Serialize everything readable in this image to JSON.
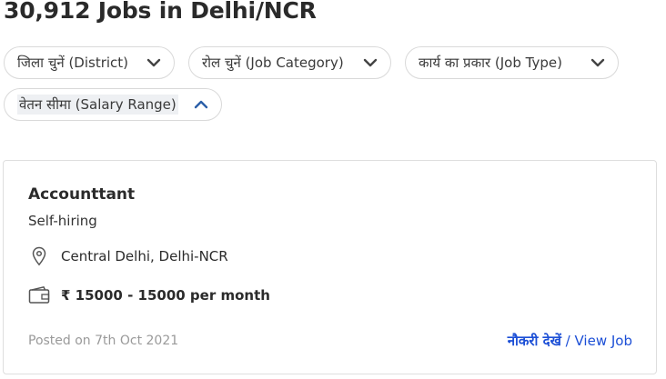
{
  "header": {
    "title": "30,912 Jobs in Delhi/NCR"
  },
  "filters": [
    {
      "label": "जिला चुनें (District)",
      "state": "collapsed"
    },
    {
      "label": "रोल चुनें (Job Category)",
      "state": "collapsed"
    },
    {
      "label": "कार्य का प्रकार (Job Type)",
      "state": "collapsed"
    },
    {
      "label": "वेतन सीमा (Salary Range)",
      "state": "expanded"
    }
  ],
  "job": {
    "title": "Accounttant",
    "company": "Self-hiring",
    "location": "Central Delhi, Delhi-NCR",
    "salary": "₹ 15000 - 15000 per month",
    "posted": "Posted on 7th Oct 2021",
    "view_hindi": "नौकरी देखें",
    "view_sep": " / ",
    "view_english": "View Job"
  },
  "colors": {
    "link": "#1c4fd6",
    "border": "#d9d9d9",
    "muted": "#9a9a9a"
  },
  "icons": {
    "location": "map-pin-icon",
    "salary": "wallet-icon",
    "expand": "chevron-down-icon",
    "collapse": "chevron-up-icon"
  }
}
